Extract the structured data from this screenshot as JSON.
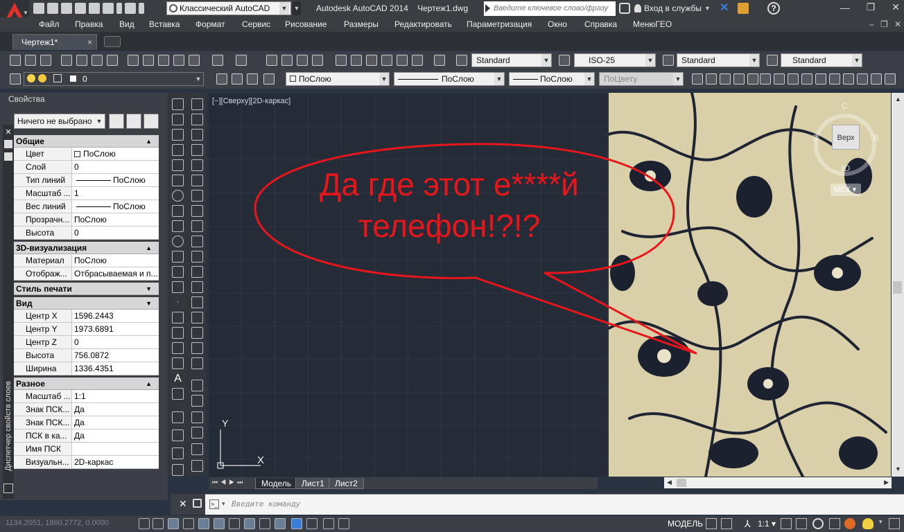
{
  "title_bar": {
    "workspace": "Классический AutoCAD",
    "app_title": "Autodesk AutoCAD 2014    Чертеж1.dwg",
    "search_placeholder": "Введите ключевое слово/фразу",
    "login": "Вход в службы",
    "help": "?"
  },
  "menu": [
    "Файл",
    "Правка",
    "Вид",
    "Вставка",
    "Формат",
    "Сервис",
    "Рисование",
    "Размеры",
    "Редактировать",
    "Параметризация",
    "Окно",
    "Справка",
    "МенюГЕО"
  ],
  "tabs": [
    {
      "label": "Чертеж1*",
      "close": "×"
    }
  ],
  "toolbar1": {
    "text_style": "Standard",
    "dim_style": "ISO-25",
    "table_style": "Standard",
    "multileader_style": "Standard"
  },
  "toolbar2": {
    "layer": "0",
    "color": "ПоСлою",
    "linetype": "ПоСлою",
    "lineweight": "ПоСлою",
    "plotstyle": "ПоЦвету"
  },
  "properties": {
    "header": "Свойства",
    "selection": "Ничего не выбрано",
    "side_label": "Диспетчер свойств слоев",
    "sections": [
      {
        "title": "Общие",
        "rows": [
          {
            "k": "Цвет",
            "v": "ПоСлою"
          },
          {
            "k": "Слой",
            "v": "0"
          },
          {
            "k": "Тип линий",
            "v": "ПоСлою"
          },
          {
            "k": "Масштаб ...",
            "v": "1"
          },
          {
            "k": "Вес линий",
            "v": "ПоСлою"
          },
          {
            "k": "Прозрачн...",
            "v": "ПоСлою"
          },
          {
            "k": "Высота",
            "v": "0"
          }
        ]
      },
      {
        "title": "3D-визуализация",
        "rows": [
          {
            "k": "Материал",
            "v": "ПоСлою"
          },
          {
            "k": "Отображ...",
            "v": "Отбрасываемая и п..."
          }
        ]
      },
      {
        "title": "Стиль печати",
        "rows": []
      },
      {
        "title": "Вид",
        "rows": [
          {
            "k": "Центр X",
            "v": "1596.2443"
          },
          {
            "k": "Центр Y",
            "v": "1973.6891"
          },
          {
            "k": "Центр Z",
            "v": "0"
          },
          {
            "k": "Высота",
            "v": "756.0872"
          },
          {
            "k": "Ширина",
            "v": "1336.4351"
          }
        ]
      },
      {
        "title": "Разное",
        "rows": [
          {
            "k": "Масштаб ...",
            "v": "1:1"
          },
          {
            "k": "Знак ПСК...",
            "v": "Да"
          },
          {
            "k": "Знак ПСК...",
            "v": "Да"
          },
          {
            "k": "ПСК в ка...",
            "v": "Да"
          },
          {
            "k": "Имя ПСК",
            "v": ""
          },
          {
            "k": "Визуальн...",
            "v": "2D-каркас"
          }
        ]
      }
    ]
  },
  "viewport": {
    "label": "[−][Сверху][2D-каркас]",
    "ucs_y": "Y",
    "ucs_x": "X",
    "bubble_line1": "Да где этот е****й",
    "bubble_line2": "телефон!?!?",
    "bubble_color": "#e8151a"
  },
  "viewcube": {
    "face": "Верх",
    "n": "С",
    "s": "Ю",
    "w": "З",
    "e": "В",
    "ucs": "МСК"
  },
  "layout_tabs": [
    "Модель",
    "Лист1",
    "Лист2"
  ],
  "command": {
    "placeholder": "Введите команду"
  },
  "status": {
    "coords": "1134.2051, 1860.2772, 0.0000",
    "model": "МОДЕЛЬ",
    "scale": "1:1"
  }
}
